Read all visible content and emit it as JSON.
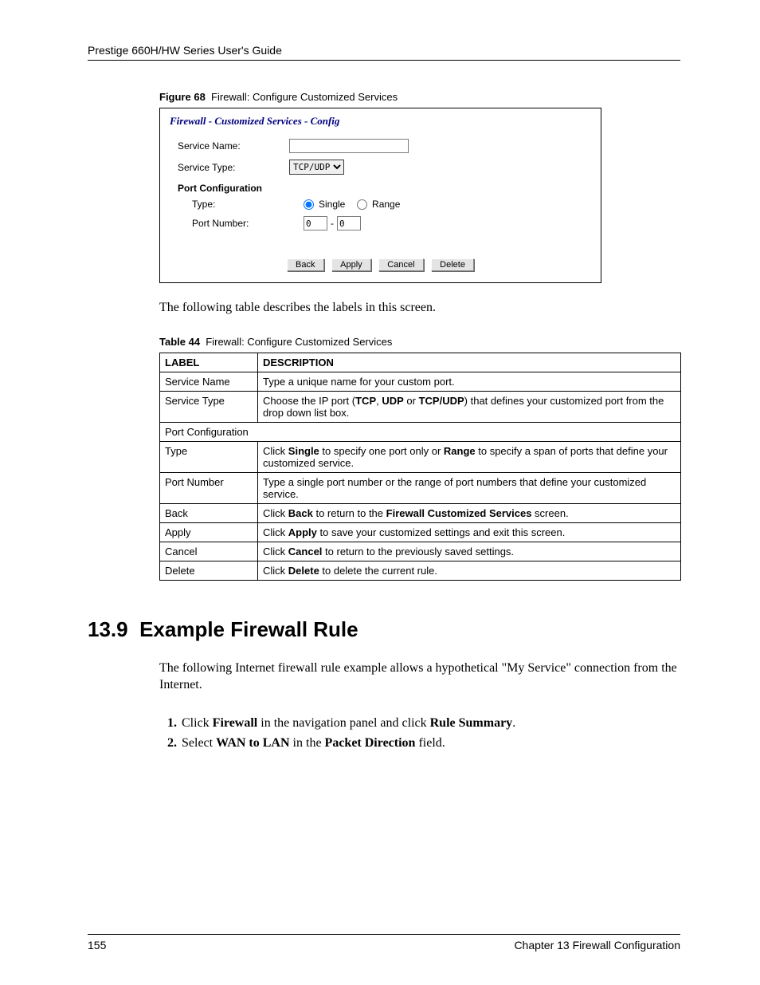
{
  "header": {
    "running_head": "Prestige 660H/HW Series User's Guide"
  },
  "figure": {
    "label": "Figure 68",
    "caption": "Firewall: Configure Customized Services",
    "panel_title": "Firewall - Customized Services - Config",
    "fields": {
      "service_name_label": "Service Name:",
      "service_name_value": "",
      "service_type_label": "Service Type:",
      "service_type_value": "TCP/UDP",
      "port_config_heading": "Port Configuration",
      "type_label": "Type:",
      "radio_single": "Single",
      "radio_range": "Range",
      "port_number_label": "Port Number:",
      "port_from": "0",
      "port_to": "0",
      "dash": "-"
    },
    "buttons": {
      "back": "Back",
      "apply": "Apply",
      "cancel": "Cancel",
      "delete": "Delete"
    }
  },
  "intro_para": "The following table describes the labels in this screen.",
  "table": {
    "label": "Table 44",
    "caption": "Firewall: Configure Customized Services",
    "head_label": "LABEL",
    "head_desc": "DESCRIPTION",
    "rows": [
      {
        "label": "Service Name",
        "desc": "Type a unique name for your custom port."
      },
      {
        "label": "Service Type",
        "desc": "Choose the IP port (<b>TCP</b>, <b>UDP</b> or <b>TCP/UDP</b>) that defines your customized port from the drop down list box."
      },
      {
        "label": "Port Configuration",
        "desc": "",
        "span": true
      },
      {
        "label": "Type",
        "desc": "Click <b>Single</b> to specify one port only or <b>Range</b> to specify a span of ports that define your customized service."
      },
      {
        "label": "Port Number",
        "desc": "Type a single port number or the range of port numbers that define your customized service."
      },
      {
        "label": "Back",
        "desc": "Click <b>Back</b> to return to the <b>Firewall Customized Services</b> screen."
      },
      {
        "label": "Apply",
        "desc": "Click <b>Apply</b> to save your customized settings and exit this screen."
      },
      {
        "label": "Cancel",
        "desc": "Click <b>Cancel</b> to return to the previously saved settings."
      },
      {
        "label": "Delete",
        "desc": "Click <b>Delete</b> to delete the current rule."
      }
    ]
  },
  "section": {
    "number": "13.9",
    "title": "Example Firewall Rule",
    "para": "The following Internet firewall rule example allows a hypothetical \"My Service\" connection from the Internet.",
    "steps": [
      "Click <b>Firewall</b> in the navigation panel and click <b>Rule Summary</b>.",
      "Select <b>WAN to LAN</b> in the <b>Packet Direction</b> field."
    ]
  },
  "footer": {
    "page": "155",
    "chapter": "Chapter 13 Firewall Configuration"
  }
}
